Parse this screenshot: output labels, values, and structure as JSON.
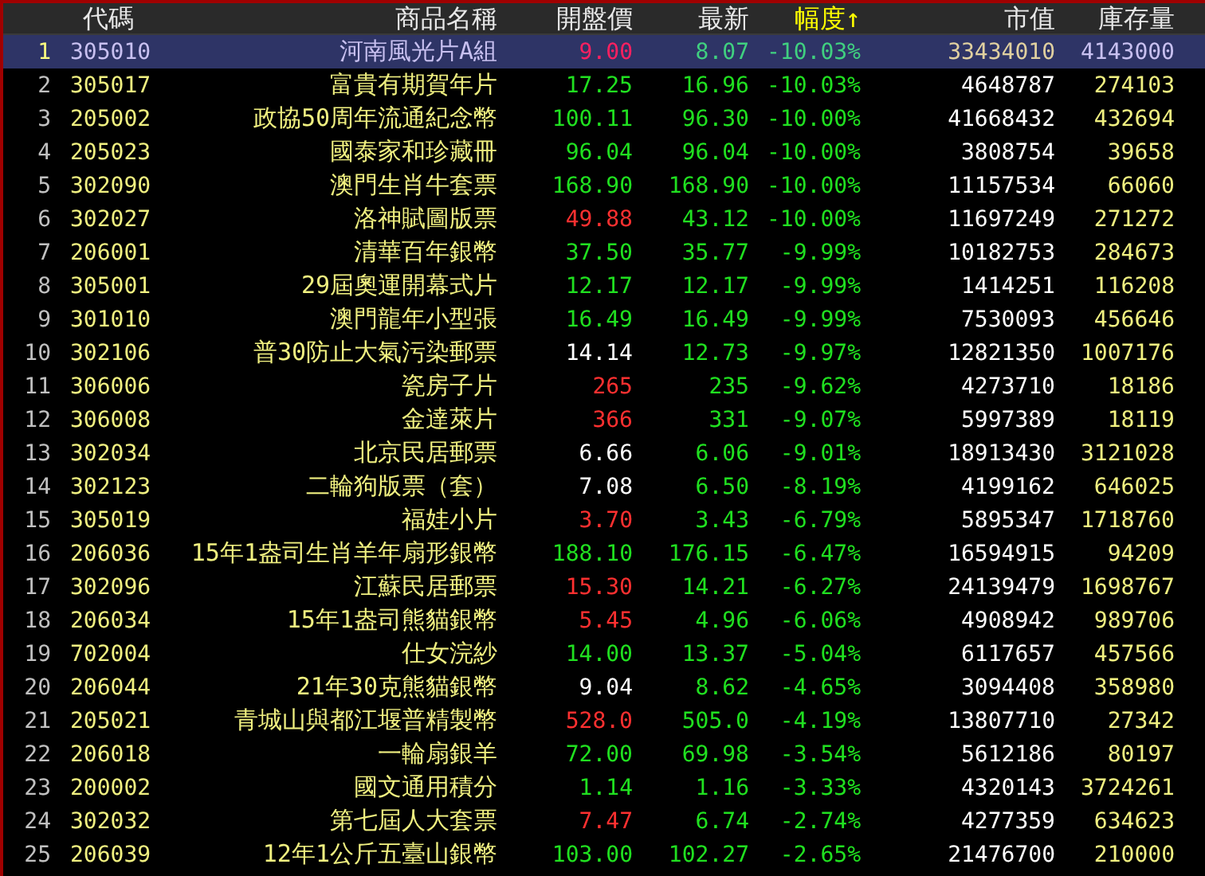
{
  "columns": [
    {
      "label": "代碼",
      "sorted": false
    },
    {
      "label": "商品名稱",
      "sorted": false
    },
    {
      "label": "開盤價",
      "sorted": false
    },
    {
      "label": "最新",
      "sorted": false
    },
    {
      "label": "幅度↑",
      "sorted": true
    },
    {
      "label": "市值",
      "sorted": false
    },
    {
      "label": "庫存量",
      "sorted": false
    }
  ],
  "rows": [
    {
      "index": "1",
      "code": "305010",
      "name": "河南風光片A組",
      "open": "9.00",
      "color": "#ff2060",
      "latest": "8.07",
      "change": "-10.03%",
      "market_value": "33434010",
      "stock": "4143000",
      "selected": true
    },
    {
      "index": "2",
      "code": "305017",
      "name": "富貴有期賀年片",
      "open": "17.25",
      "color": "#20e020",
      "latest": "16.96",
      "change": "-10.03%",
      "market_value": "4648787",
      "stock": "274103",
      "selected": false
    },
    {
      "index": "3",
      "code": "205002",
      "name": "政協50周年流通紀念幣",
      "open": "100.11",
      "color": "#20e020",
      "latest": "96.30",
      "change": "-10.00%",
      "market_value": "41668432",
      "stock": "432694",
      "selected": false
    },
    {
      "index": "4",
      "code": "205023",
      "name": "國泰家和珍藏冊",
      "open": "96.04",
      "color": "#20e020",
      "latest": "96.04",
      "change": "-10.00%",
      "market_value": "3808754",
      "stock": "39658",
      "selected": false
    },
    {
      "index": "5",
      "code": "302090",
      "name": "澳門生肖牛套票",
      "open": "168.90",
      "color": "#20e020",
      "latest": "168.90",
      "change": "-10.00%",
      "market_value": "11157534",
      "stock": "66060",
      "selected": false
    },
    {
      "index": "6",
      "code": "302027",
      "name": "洛神賦圖版票",
      "open": "49.88",
      "color": "#ff3030",
      "latest": "43.12",
      "change": "-10.00%",
      "market_value": "11697249",
      "stock": "271272",
      "selected": false
    },
    {
      "index": "7",
      "code": "206001",
      "name": "清華百年銀幣",
      "open": "37.50",
      "color": "#20e020",
      "latest": "35.77",
      "change": "-9.99%",
      "market_value": "10182753",
      "stock": "284673",
      "selected": false
    },
    {
      "index": "8",
      "code": "305001",
      "name": "29屆奧運開幕式片",
      "open": "12.17",
      "color": "#20e020",
      "latest": "12.17",
      "change": "-9.99%",
      "market_value": "1414251",
      "stock": "116208",
      "selected": false
    },
    {
      "index": "9",
      "code": "301010",
      "name": "澳門龍年小型張",
      "open": "16.49",
      "color": "#20e020",
      "latest": "16.49",
      "change": "-9.99%",
      "market_value": "7530093",
      "stock": "456646",
      "selected": false
    },
    {
      "index": "10",
      "code": "302106",
      "name": "普30防止大氣污染郵票",
      "open": "14.14",
      "color": "#ffffff",
      "latest": "12.73",
      "change": "-9.97%",
      "market_value": "12821350",
      "stock": "1007176",
      "selected": false
    },
    {
      "index": "11",
      "code": "306006",
      "name": "瓷房子片",
      "open": "265",
      "color": "#ff3030",
      "latest": "235",
      "change": "-9.62%",
      "market_value": "4273710",
      "stock": "18186",
      "selected": false
    },
    {
      "index": "12",
      "code": "306008",
      "name": "金達萊片",
      "open": "366",
      "color": "#ff3030",
      "latest": "331",
      "change": "-9.07%",
      "market_value": "5997389",
      "stock": "18119",
      "selected": false
    },
    {
      "index": "13",
      "code": "302034",
      "name": "北京民居郵票",
      "open": "6.66",
      "color": "#ffffff",
      "latest": "6.06",
      "change": "-9.01%",
      "market_value": "18913430",
      "stock": "3121028",
      "selected": false
    },
    {
      "index": "14",
      "code": "302123",
      "name": "二輪狗版票（套）",
      "open": "7.08",
      "color": "#ffffff",
      "latest": "6.50",
      "change": "-8.19%",
      "market_value": "4199162",
      "stock": "646025",
      "selected": false
    },
    {
      "index": "15",
      "code": "305019",
      "name": "福娃小片",
      "open": "3.70",
      "color": "#ff3030",
      "latest": "3.43",
      "change": "-6.79%",
      "market_value": "5895347",
      "stock": "1718760",
      "selected": false
    },
    {
      "index": "16",
      "code": "206036",
      "name": "15年1盎司生肖羊年扇形銀幣",
      "open": "188.10",
      "color": "#20e020",
      "latest": "176.15",
      "change": "-6.47%",
      "market_value": "16594915",
      "stock": "94209",
      "selected": false
    },
    {
      "index": "17",
      "code": "302096",
      "name": "江蘇民居郵票",
      "open": "15.30",
      "color": "#ff3030",
      "latest": "14.21",
      "change": "-6.27%",
      "market_value": "24139479",
      "stock": "1698767",
      "selected": false
    },
    {
      "index": "18",
      "code": "206034",
      "name": "15年1盎司熊貓銀幣",
      "open": "5.45",
      "color": "#ff3030",
      "latest": "4.96",
      "change": "-6.06%",
      "market_value": "4908942",
      "stock": "989706",
      "selected": false
    },
    {
      "index": "19",
      "code": "702004",
      "name": "仕女浣紗",
      "open": "14.00",
      "color": "#20e020",
      "latest": "13.37",
      "change": "-5.04%",
      "market_value": "6117657",
      "stock": "457566",
      "selected": false
    },
    {
      "index": "20",
      "code": "206044",
      "name": "21年30克熊貓銀幣",
      "open": "9.04",
      "color": "#ffffff",
      "latest": "8.62",
      "change": "-4.65%",
      "market_value": "3094408",
      "stock": "358980",
      "selected": false
    },
    {
      "index": "21",
      "code": "205021",
      "name": "青城山與都江堰普精製幣",
      "open": "528.0",
      "color": "#ff3030",
      "latest": "505.0",
      "change": "-4.19%",
      "market_value": "13807710",
      "stock": "27342",
      "selected": false
    },
    {
      "index": "22",
      "code": "206018",
      "name": "一輪扇銀羊",
      "open": "72.00",
      "color": "#20e020",
      "latest": "69.98",
      "change": "-3.54%",
      "market_value": "5612186",
      "stock": "80197",
      "selected": false
    },
    {
      "index": "23",
      "code": "200002",
      "name": "國文通用積分",
      "open": "1.14",
      "color": "#20e020",
      "latest": "1.16",
      "change": "-3.33%",
      "market_value": "4320143",
      "stock": "3724261",
      "selected": false
    },
    {
      "index": "24",
      "code": "302032",
      "name": "第七屆人大套票",
      "open": "7.47",
      "color": "#ff3030",
      "latest": "6.74",
      "change": "-2.74%",
      "market_value": "4277359",
      "stock": "634623",
      "selected": false
    },
    {
      "index": "25",
      "code": "206039",
      "name": "12年1公斤五臺山銀幣",
      "open": "103.00",
      "color": "#20e020",
      "latest": "102.27",
      "change": "-2.65%",
      "market_value": "21476700",
      "stock": "210000",
      "selected": false
    }
  ]
}
